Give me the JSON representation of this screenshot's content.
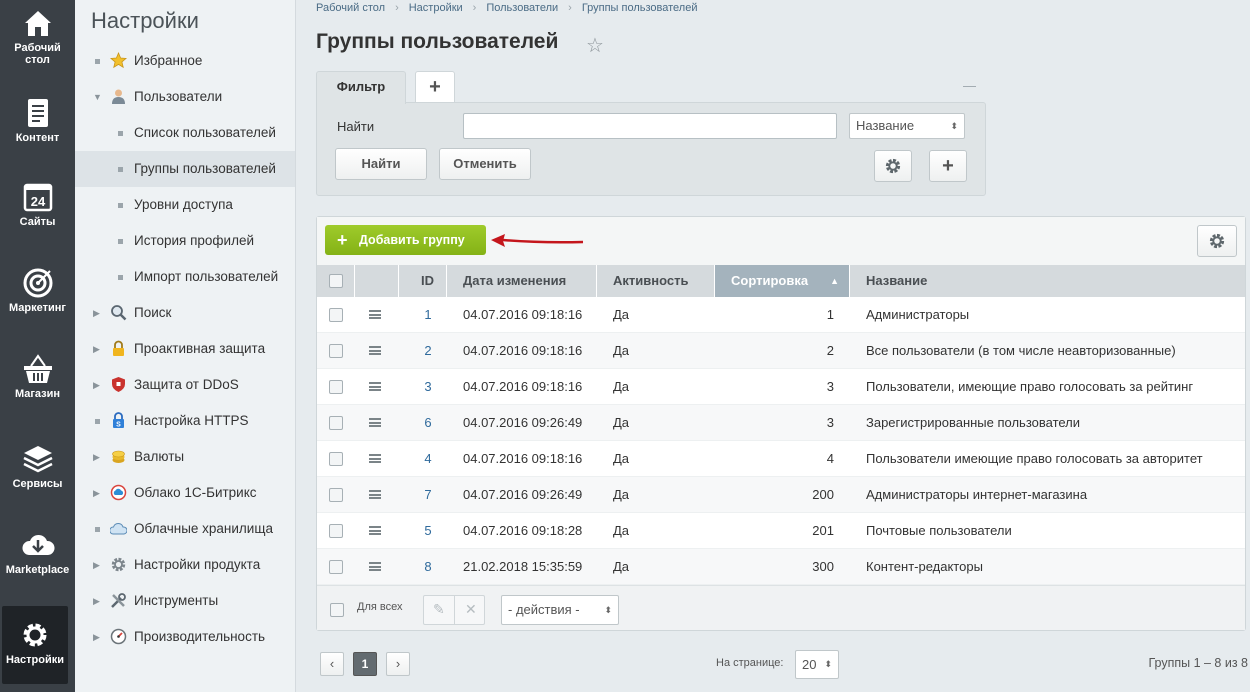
{
  "left_nav": [
    {
      "label": "Рабочий стол",
      "icon": "home-icon"
    },
    {
      "label": "Контент",
      "icon": "document-icon"
    },
    {
      "label": "Сайты",
      "icon": "calendar-24-icon"
    },
    {
      "label": "Маркетинг",
      "icon": "target-icon"
    },
    {
      "label": "Магазин",
      "icon": "basket-icon"
    },
    {
      "label": "Сервисы",
      "icon": "layers-icon"
    },
    {
      "label": "Marketplace",
      "icon": "cloud-download-icon"
    },
    {
      "label": "Настройки",
      "icon": "gear-icon"
    }
  ],
  "left_nav_lines": {
    "desktop_1": "Рабочий",
    "desktop_2": "стол"
  },
  "menu": {
    "title": "Настройки",
    "items": [
      {
        "label": "Избранное",
        "icon": "star-icon"
      },
      {
        "label": "Пользователи",
        "icon": "user-icon"
      },
      {
        "label": "Список пользователей"
      },
      {
        "label": "Группы пользователей"
      },
      {
        "label": "Уровни доступа"
      },
      {
        "label": "История профилей"
      },
      {
        "label": "Импорт пользователей"
      },
      {
        "label": "Поиск",
        "icon": "search-icon"
      },
      {
        "label": "Проактивная защита",
        "icon": "lock-icon"
      },
      {
        "label": "Защита от DDoS",
        "icon": "shield-icon"
      },
      {
        "label": "Настройка HTTPS",
        "icon": "https-lock-icon"
      },
      {
        "label": "Валюты",
        "icon": "coins-icon"
      },
      {
        "label": "Облако 1С-Битрикс",
        "icon": "cloud-icon"
      },
      {
        "label": "Облачные хранилища",
        "icon": "storage-icon"
      },
      {
        "label": "Настройки продукта",
        "icon": "cog-icon"
      },
      {
        "label": "Инструменты",
        "icon": "tools-icon"
      },
      {
        "label": "Производительность",
        "icon": "speedometer-icon"
      }
    ]
  },
  "breadcrumb": [
    "Рабочий стол",
    "Настройки",
    "Пользователи",
    "Группы пользователей"
  ],
  "breadcrumb_sep": "›",
  "page_title": "Группы пользователей",
  "filter": {
    "tab_label": "Фильтр",
    "add_tab_label": "+",
    "collapse_label": "—",
    "find_label": "Найти",
    "find_value": "",
    "field_select": "Название",
    "find_button": "Найти",
    "cancel_button": "Отменить",
    "plus_button": "+"
  },
  "grid": {
    "add_button": "Добавить группу",
    "columns": {
      "id": "ID",
      "date": "Дата изменения",
      "active": "Активность",
      "sort": "Сортировка",
      "name": "Название"
    },
    "sort_indicator": "▲",
    "rows": [
      {
        "id": "1",
        "date": "04.07.2016 09:18:16",
        "active": "Да",
        "sort": "1",
        "name": "Администраторы"
      },
      {
        "id": "2",
        "date": "04.07.2016 09:18:16",
        "active": "Да",
        "sort": "2",
        "name": "Все пользователи (в том числе неавторизованные)"
      },
      {
        "id": "3",
        "date": "04.07.2016 09:18:16",
        "active": "Да",
        "sort": "3",
        "name": "Пользователи, имеющие право голосовать за рейтинг"
      },
      {
        "id": "6",
        "date": "04.07.2016 09:26:49",
        "active": "Да",
        "sort": "3",
        "name": "Зарегистрированные пользователи"
      },
      {
        "id": "4",
        "date": "04.07.2016 09:18:16",
        "active": "Да",
        "sort": "4",
        "name": "Пользователи имеющие право голосовать за авторитет"
      },
      {
        "id": "7",
        "date": "04.07.2016 09:26:49",
        "active": "Да",
        "sort": "200",
        "name": "Администраторы интернет-магазина"
      },
      {
        "id": "5",
        "date": "04.07.2016 09:18:28",
        "active": "Да",
        "sort": "201",
        "name": "Почтовые пользователи"
      },
      {
        "id": "8",
        "date": "21.02.2018 15:35:59",
        "active": "Да",
        "sort": "300",
        "name": "Контент-редакторы"
      }
    ],
    "for_all": "Для всех",
    "actions_select": "- действия -"
  },
  "pagination": {
    "prev": "‹",
    "current": "1",
    "next": "›",
    "per_page_label": "На странице:",
    "per_page_value": "20",
    "summary": "Группы 1 – 8 из 8"
  },
  "colors": {
    "accent_green": "#8dbc1c",
    "link_blue": "#2f6a9c",
    "arrow_red": "#c4161c",
    "sort_header": "#a4b3bd"
  }
}
